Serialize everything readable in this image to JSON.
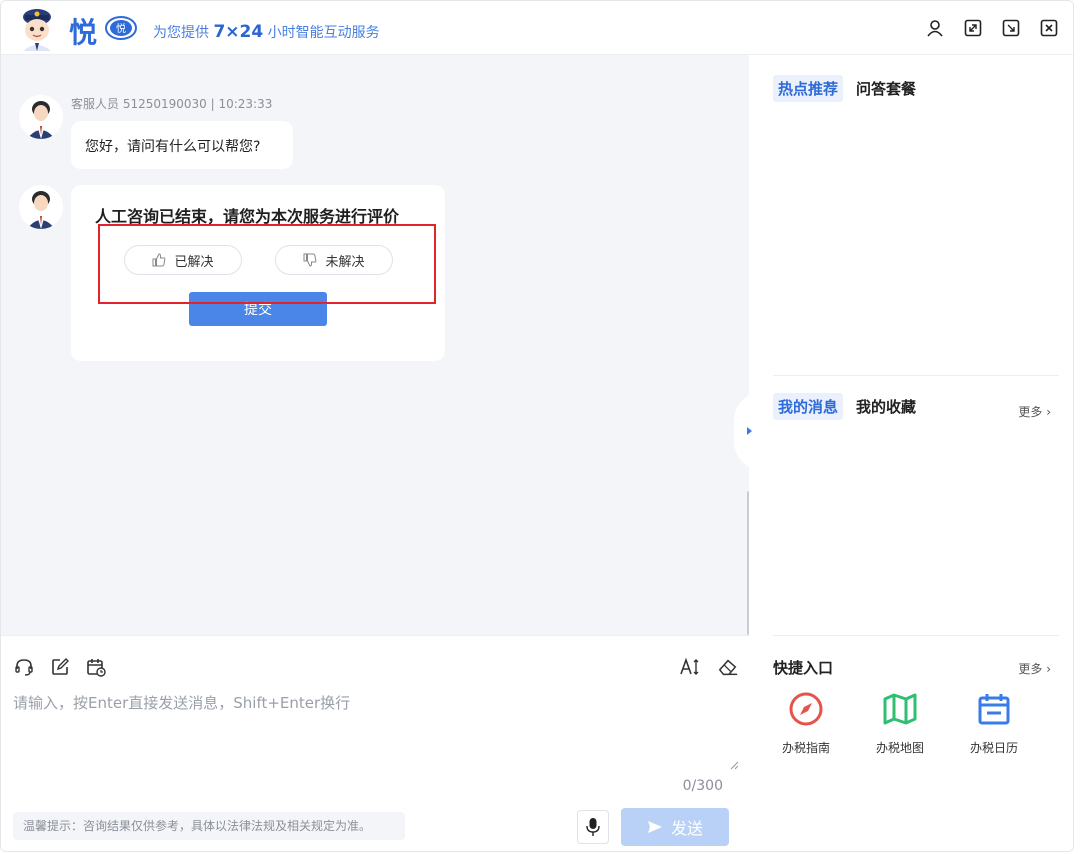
{
  "header": {
    "brand_char": "悦",
    "badge_text": "悦",
    "slogan_prefix": "为您提供 ",
    "slogan_highlight": "7×24",
    "slogan_suffix": " 小时智能互动服务"
  },
  "chat": {
    "messages": [
      {
        "meta": "客服人员 51250190030 | 10:23:33",
        "text": "您好，请问有什么可以帮您?"
      }
    ],
    "evaluation": {
      "title": "人工咨询已结束，请您为本次服务进行评价",
      "resolved_label": "已解决",
      "unresolved_label": "未解决",
      "submit_label": "提交"
    }
  },
  "input": {
    "placeholder": "请输入，按Enter直接发送消息，Shift+Enter换行",
    "counter": "0/300",
    "tip": "温馨提示：咨询结果仅供参考，具体以法律法规及相关规定为准。",
    "send_label": "发送"
  },
  "right": {
    "top_tabs": [
      "热点推荐",
      "问答套餐"
    ],
    "mid_tabs": [
      "我的消息",
      "我的收藏"
    ],
    "more_label": "更多",
    "quick_title": "快捷入口",
    "quick_items": [
      {
        "label": "办税指南",
        "icon": "compass-icon",
        "color": "#e5534b"
      },
      {
        "label": "办税地图",
        "icon": "map-icon",
        "color": "#2fbf71"
      },
      {
        "label": "办税日历",
        "icon": "calendar-icon",
        "color": "#3a7be8"
      }
    ]
  },
  "colors": {
    "accent": "#2f6bd8",
    "submit": "#4a86e8",
    "send_disabled": "#b9d1f7",
    "highlight_box": "#e1242b"
  }
}
